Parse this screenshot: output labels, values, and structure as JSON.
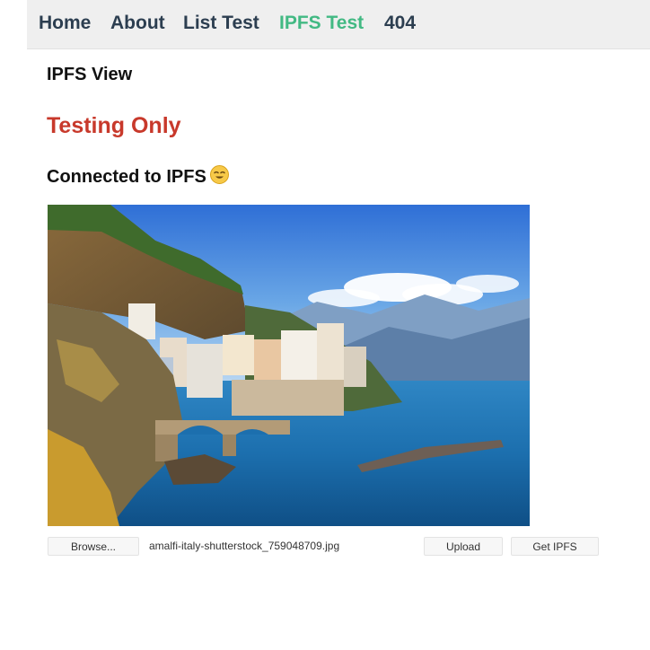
{
  "nav": {
    "items": [
      {
        "label": "Home",
        "active": false
      },
      {
        "label": "About",
        "active": false
      },
      {
        "label": "List Test",
        "active": false
      },
      {
        "label": "IPFS Test",
        "active": true
      },
      {
        "label": "404",
        "active": false
      }
    ]
  },
  "main": {
    "view_title": "IPFS View",
    "warning": "Testing Only",
    "status": "Connected to IPFS",
    "status_emoji": "smiling-face-icon",
    "colors": {
      "nav_active": "#42b983",
      "nav_text": "#2c3e50",
      "warning": "#c8392b"
    }
  },
  "upload": {
    "browse_label": "Browse...",
    "file_name": "amalfi-italy-shutterstock_759048709.jpg",
    "upload_label": "Upload",
    "get_label": "Get IPFS"
  }
}
